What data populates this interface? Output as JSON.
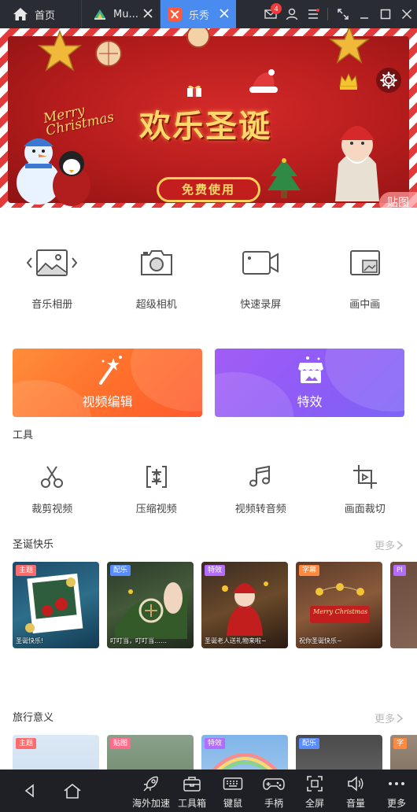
{
  "titlebar": {
    "tabs": [
      {
        "label": "首页"
      },
      {
        "label": "Mu..."
      },
      {
        "label": "乐秀"
      }
    ],
    "mail_badge": "4"
  },
  "banner": {
    "title": "欢乐圣诞",
    "button_label": "免费使用",
    "merry_line1": "Merry",
    "merry_line2": "Christmas",
    "sticker_label": "贴图"
  },
  "quick_tools": [
    {
      "label": "音乐相册",
      "icon": "photo-album-icon"
    },
    {
      "label": "超级相机",
      "icon": "camera-icon"
    },
    {
      "label": "快速录屏",
      "icon": "screen-record-icon"
    },
    {
      "label": "画中画",
      "icon": "picture-in-picture-icon"
    }
  ],
  "cards": {
    "edit_label": "视频编辑",
    "fx_label": "特效"
  },
  "tools": {
    "title": "工具",
    "items": [
      {
        "label": "裁剪视频",
        "icon": "scissors-icon"
      },
      {
        "label": "压缩视频",
        "icon": "compress-icon"
      },
      {
        "label": "视频转音频",
        "icon": "music-note-icon"
      },
      {
        "label": "画面裁切",
        "icon": "crop-icon"
      }
    ]
  },
  "christmas": {
    "title": "圣诞快乐",
    "more": "更多",
    "items": [
      {
        "badge": "主题",
        "caption": "圣诞快乐!"
      },
      {
        "badge": "配乐",
        "caption": "叮叮当，叮叮当……"
      },
      {
        "badge": "特效",
        "caption": "圣诞老人送礼物来啦~"
      },
      {
        "badge": "字幕",
        "caption": "祝你圣诞快乐~"
      },
      {
        "badge": "Pl",
        "caption": ""
      }
    ],
    "card_text": "Merry Christmas"
  },
  "travel": {
    "title": "旅行意义",
    "more": "更多",
    "items": [
      {
        "badge": "主题"
      },
      {
        "badge": "贴图"
      },
      {
        "badge": "特效"
      },
      {
        "badge": "配乐"
      },
      {
        "badge": "字"
      }
    ]
  },
  "bottombar": {
    "items": [
      {
        "label": "海外加速"
      },
      {
        "label": "工具箱"
      },
      {
        "label": "键鼠"
      },
      {
        "label": "手柄"
      },
      {
        "label": "全屏"
      },
      {
        "label": "音量"
      },
      {
        "label": "更多"
      }
    ]
  },
  "colors": {
    "accent_tab": "#4a8bf0",
    "edit_card": "#ff6e2b",
    "fx_card": "#8f5cf6",
    "badge_orange": "#ff8a3d",
    "badge_blue": "#5b8cff",
    "badge_purple": "#b36cff",
    "badge_red": "#ff5b5b"
  }
}
